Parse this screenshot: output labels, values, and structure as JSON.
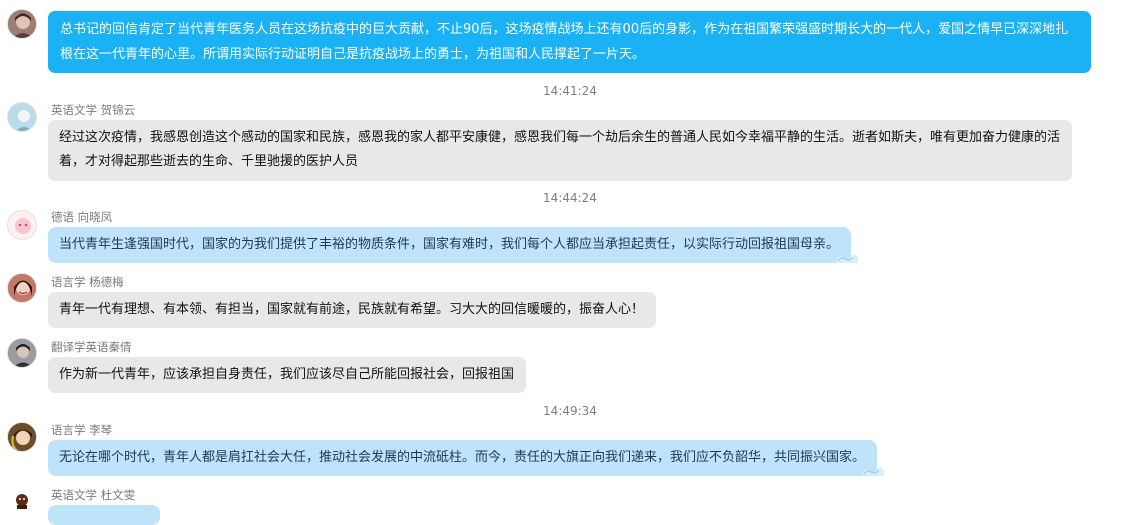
{
  "messages": [
    {
      "sender": "",
      "text": "总书记的回信肯定了当代青年医务人员在这场抗疫中的巨大贡献，不止90后，这场疫情战场上还有00后的身影，作为在祖国繁荣强盛时期长大的一代人，爱国之情早已深深地扎根在这一代青年的心里。所谓用实际行动证明自己是抗疫战场上的勇士，为祖国和人民撑起了一片天。"
    },
    {
      "sender": "英语文学 贺锦云",
      "text": "经过这次疫情，我感恩创造这个感动的国家和民族，感恩我的家人都平安康健，感恩我们每一个劫后余生的普通人民如今幸福平静的生活。逝者如斯夫，唯有更加奋力健康的活着，才对得起那些逝去的生命、千里驰援的医护人员"
    },
    {
      "sender": "德语 向晓凤",
      "text": "当代青年生逢强国时代，国家的为我们提供了丰裕的物质条件，国家有难时，我们每个人都应当承担起责任，以实际行动回报祖国母亲。"
    },
    {
      "sender": "语言学  杨德梅",
      "text": "青年一代有理想、有本领、有担当，国家就有前途，民族就有希望。习大大的回信暖暖的，振奋人心！"
    },
    {
      "sender": "翻译学英语秦倩",
      "text": "作为新一代青年，应该承担自身责任，我们应该尽自己所能回报社会，回报祖国"
    },
    {
      "sender": "语言学   李琴",
      "text": "无论在哪个时代，青年人都是肩扛社会大任，推动社会发展的中流砥柱。而今，责任的大旗正向我们递来，我们应不负韶华，共同振兴国家。"
    },
    {
      "sender": "英语文学 杜文雯",
      "text": ""
    }
  ],
  "timestamps": [
    "14:41:24",
    "14:44:24",
    "14:49:34"
  ],
  "colors": {
    "blue_bubble": "#1ab2f5",
    "gray_bubble": "#e8e8e8",
    "light_blue_bubble": "#bfe3f9"
  }
}
